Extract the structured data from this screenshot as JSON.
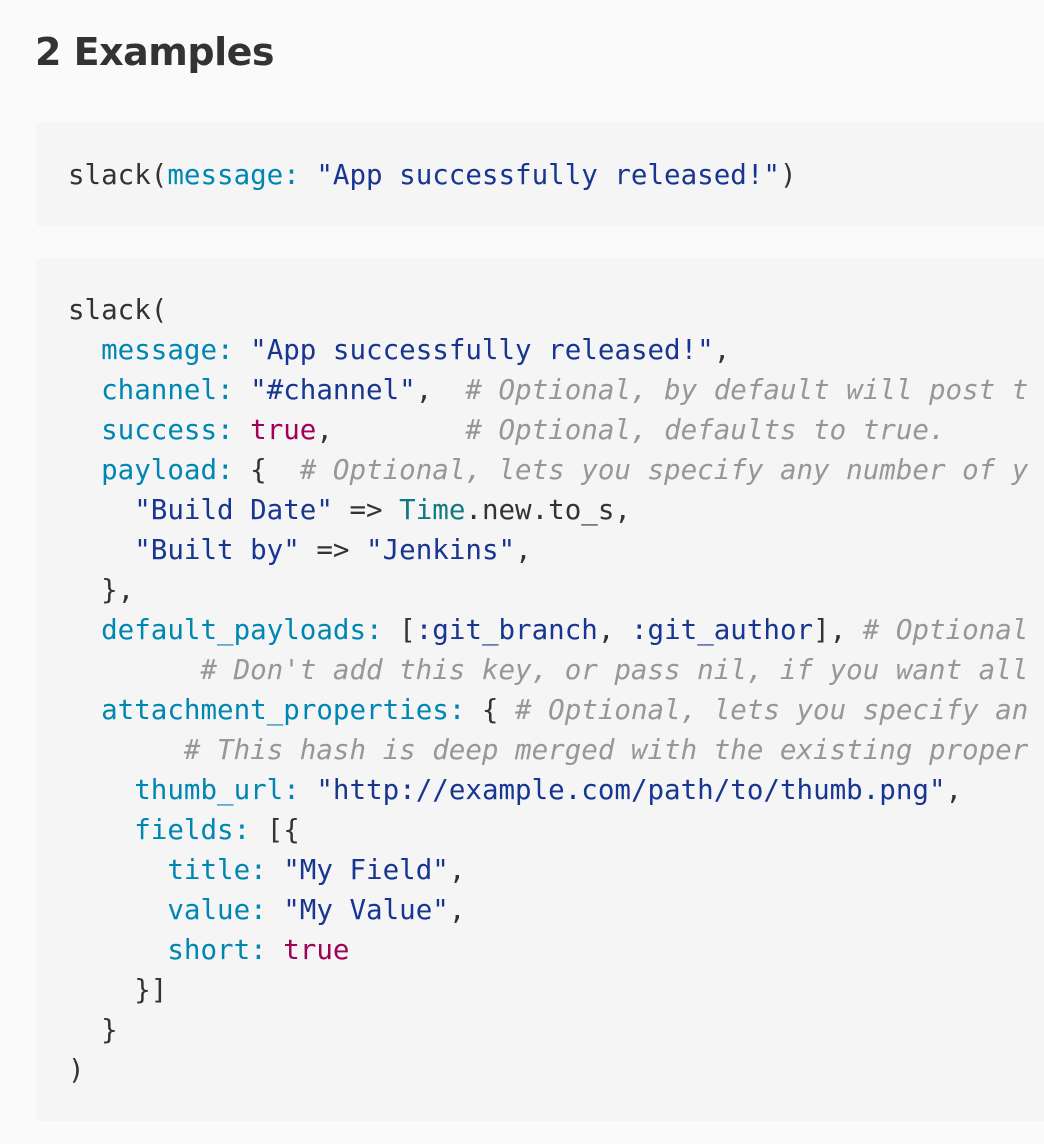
{
  "heading": "2 Examples",
  "colors": {
    "page_background": "#fafafa",
    "code_background": "#f5f5f5",
    "plain": "#333333",
    "key": "#0086b3",
    "string": "#183691",
    "boolean": "#a00058",
    "constant": "#0f7a80",
    "comment": "#969896"
  },
  "examples": [
    {
      "lines": [
        [
          {
            "type": "plain",
            "text": "slack("
          },
          {
            "type": "key",
            "text": "message:"
          },
          {
            "type": "plain",
            "text": " "
          },
          {
            "type": "str",
            "text": "\"App successfully released!\""
          },
          {
            "type": "plain",
            "text": ")"
          }
        ]
      ]
    },
    {
      "lines": [
        [
          {
            "type": "plain",
            "text": "slack("
          }
        ],
        [
          {
            "type": "plain",
            "text": "  "
          },
          {
            "type": "key",
            "text": "message:"
          },
          {
            "type": "plain",
            "text": " "
          },
          {
            "type": "str",
            "text": "\"App successfully released!\""
          },
          {
            "type": "plain",
            "text": ","
          }
        ],
        [
          {
            "type": "plain",
            "text": "  "
          },
          {
            "type": "key",
            "text": "channel:"
          },
          {
            "type": "plain",
            "text": " "
          },
          {
            "type": "str",
            "text": "\"#channel\""
          },
          {
            "type": "plain",
            "text": ",  "
          },
          {
            "type": "comment",
            "text": "# Optional, by default will post t"
          }
        ],
        [
          {
            "type": "plain",
            "text": "  "
          },
          {
            "type": "key",
            "text": "success:"
          },
          {
            "type": "plain",
            "text": " "
          },
          {
            "type": "bool",
            "text": "true"
          },
          {
            "type": "plain",
            "text": ",        "
          },
          {
            "type": "comment",
            "text": "# Optional, defaults to true."
          }
        ],
        [
          {
            "type": "plain",
            "text": "  "
          },
          {
            "type": "key",
            "text": "payload:"
          },
          {
            "type": "plain",
            "text": " {  "
          },
          {
            "type": "comment",
            "text": "# Optional, lets you specify any number of y"
          }
        ],
        [
          {
            "type": "plain",
            "text": "    "
          },
          {
            "type": "str",
            "text": "\"Build Date\""
          },
          {
            "type": "plain",
            "text": " => "
          },
          {
            "type": "const",
            "text": "Time"
          },
          {
            "type": "plain",
            "text": ".new.to_s,"
          }
        ],
        [
          {
            "type": "plain",
            "text": "    "
          },
          {
            "type": "str",
            "text": "\"Built by\""
          },
          {
            "type": "plain",
            "text": " => "
          },
          {
            "type": "str",
            "text": "\"Jenkins\""
          },
          {
            "type": "plain",
            "text": ","
          }
        ],
        [
          {
            "type": "plain",
            "text": "  },"
          }
        ],
        [
          {
            "type": "plain",
            "text": "  "
          },
          {
            "type": "key",
            "text": "default_payloads:"
          },
          {
            "type": "plain",
            "text": " ["
          },
          {
            "type": "sym",
            "text": ":git_branch"
          },
          {
            "type": "plain",
            "text": ", "
          },
          {
            "type": "sym",
            "text": ":git_author"
          },
          {
            "type": "plain",
            "text": "], "
          },
          {
            "type": "comment",
            "text": "# Optional"
          }
        ],
        [
          {
            "type": "plain",
            "text": "        "
          },
          {
            "type": "comment",
            "text": "# Don't add this key, or pass nil, if you want all"
          }
        ],
        [
          {
            "type": "plain",
            "text": "  "
          },
          {
            "type": "key",
            "text": "attachment_properties:"
          },
          {
            "type": "plain",
            "text": " { "
          },
          {
            "type": "comment",
            "text": "# Optional, lets you specify an"
          }
        ],
        [
          {
            "type": "plain",
            "text": "       "
          },
          {
            "type": "comment",
            "text": "# This hash is deep merged with the existing proper"
          }
        ],
        [
          {
            "type": "plain",
            "text": "    "
          },
          {
            "type": "key",
            "text": "thumb_url:"
          },
          {
            "type": "plain",
            "text": " "
          },
          {
            "type": "str",
            "text": "\"http://example.com/path/to/thumb.png\""
          },
          {
            "type": "plain",
            "text": ","
          }
        ],
        [
          {
            "type": "plain",
            "text": "    "
          },
          {
            "type": "key",
            "text": "fields:"
          },
          {
            "type": "plain",
            "text": " [{"
          }
        ],
        [
          {
            "type": "plain",
            "text": "      "
          },
          {
            "type": "key",
            "text": "title:"
          },
          {
            "type": "plain",
            "text": " "
          },
          {
            "type": "str",
            "text": "\"My Field\""
          },
          {
            "type": "plain",
            "text": ","
          }
        ],
        [
          {
            "type": "plain",
            "text": "      "
          },
          {
            "type": "key",
            "text": "value:"
          },
          {
            "type": "plain",
            "text": " "
          },
          {
            "type": "str",
            "text": "\"My Value\""
          },
          {
            "type": "plain",
            "text": ","
          }
        ],
        [
          {
            "type": "plain",
            "text": "      "
          },
          {
            "type": "key",
            "text": "short:"
          },
          {
            "type": "plain",
            "text": " "
          },
          {
            "type": "bool",
            "text": "true"
          }
        ],
        [
          {
            "type": "plain",
            "text": "    }]"
          }
        ],
        [
          {
            "type": "plain",
            "text": "  }"
          }
        ],
        [
          {
            "type": "plain",
            "text": ")"
          }
        ]
      ]
    }
  ]
}
